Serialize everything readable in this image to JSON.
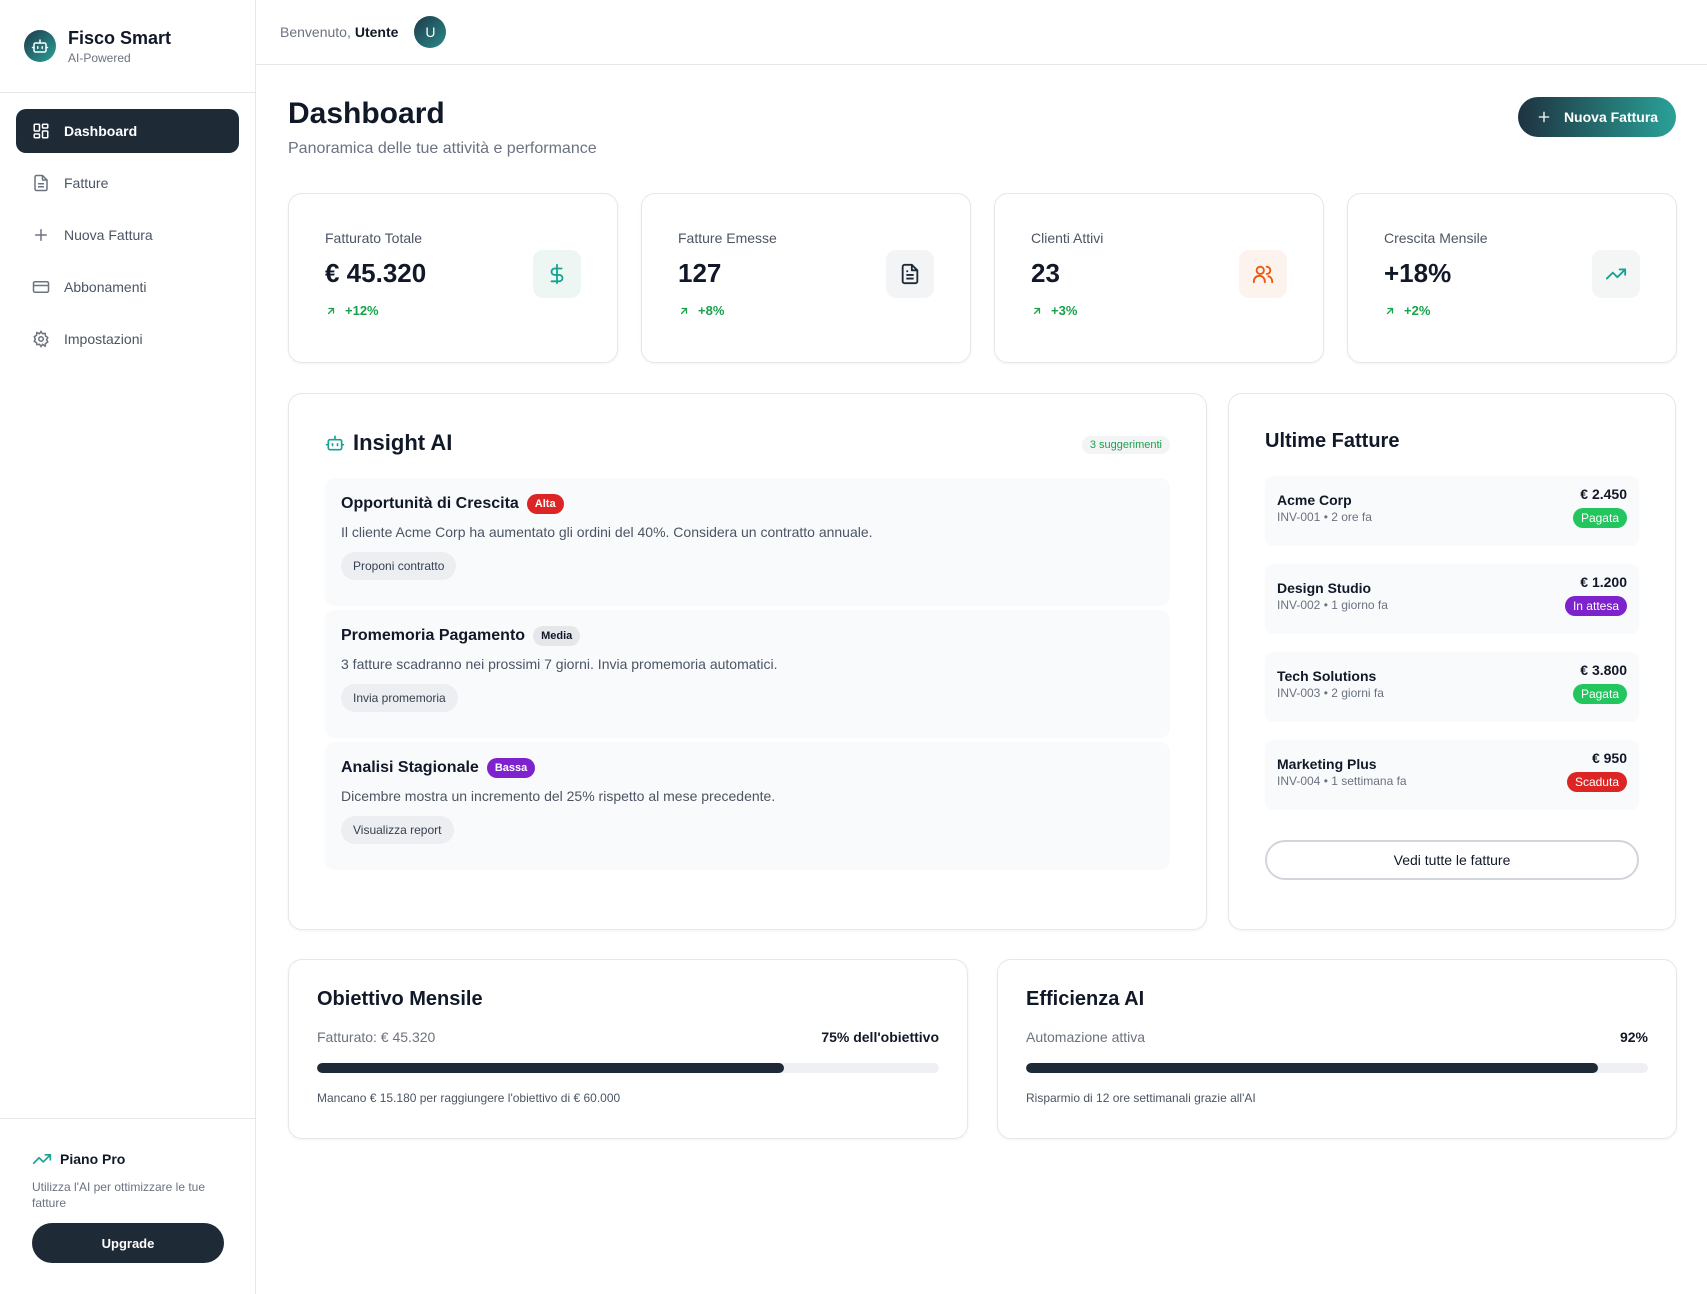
{
  "brand": {
    "title": "Fisco Smart",
    "subtitle": "AI-Powered"
  },
  "nav": [
    {
      "label": "Dashboard",
      "icon": "grid-icon",
      "active": true
    },
    {
      "label": "Fatture",
      "icon": "file-icon"
    },
    {
      "label": "Nuova Fattura",
      "icon": "plus-icon"
    },
    {
      "label": "Abbonamenti",
      "icon": "credit-card-icon"
    },
    {
      "label": "Impostazioni",
      "icon": "gear-icon"
    }
  ],
  "plan": {
    "title": "Piano Pro",
    "description": "Utilizza l'AI per ottimizzare le tue fatture",
    "button": "Upgrade"
  },
  "header": {
    "welcome": "Benvenuto,",
    "user": "Utente",
    "avatar_initial": "U"
  },
  "page": {
    "title": "Dashboard",
    "subtitle": "Panoramica delle tue attività e performance",
    "new_button": "Nuova Fattura"
  },
  "stats": [
    {
      "label": "Fatturato Totale",
      "value": "€ 45.320",
      "change": "+12%",
      "icon": "dollar-icon",
      "icon_color": "#16a394",
      "icon_bg": "#eef6f4"
    },
    {
      "label": "Fatture Emesse",
      "value": "127",
      "change": "+8%",
      "icon": "document-icon",
      "icon_color": "#1f2937",
      "icon_bg": "#f3f4f6"
    },
    {
      "label": "Clienti Attivi",
      "value": "23",
      "change": "+3%",
      "icon": "users-icon",
      "icon_color": "#ea580c",
      "icon_bg": "#fdf3ee"
    },
    {
      "label": "Crescita Mensile",
      "value": "+18%",
      "change": "+2%",
      "icon": "trending-up-icon",
      "icon_color": "#16a394",
      "icon_bg": "#f3f6f5"
    }
  ],
  "insight": {
    "title": "Insight AI",
    "badge": "3 suggerimenti",
    "items": [
      {
        "title": "Opportunità di Crescita",
        "priority": "Alta",
        "priority_bg": "#dc2626",
        "priority_color": "#ffffff",
        "description": "Il cliente Acme Corp ha aumentato gli ordini del 40%. Considera un contratto annuale.",
        "action": "Proponi contratto"
      },
      {
        "title": "Promemoria Pagamento",
        "priority": "Media",
        "priority_bg": "#e5e7eb",
        "priority_color": "#111827",
        "description": "3 fatture scadranno nei prossimi 7 giorni. Invia promemoria automatici.",
        "action": "Invia promemoria"
      },
      {
        "title": "Analisi Stagionale",
        "priority": "Bassa",
        "priority_bg": "#7e22ce",
        "priority_color": "#ffffff",
        "description": "Dicembre mostra un incremento del 25% rispetto al mese precedente.",
        "action": "Visualizza report"
      }
    ]
  },
  "invoices": {
    "title": "Ultime Fatture",
    "items": [
      {
        "client": "Acme Corp",
        "meta": "INV-001 • 2 ore fa",
        "amount": "€ 2.450",
        "status": "Pagata",
        "status_color": "#22c55e"
      },
      {
        "client": "Design Studio",
        "meta": "INV-002 • 1 giorno fa",
        "amount": "€ 1.200",
        "status": "In attesa",
        "status_color": "#7e22ce"
      },
      {
        "client": "Tech Solutions",
        "meta": "INV-003 • 2 giorni fa",
        "amount": "€ 3.800",
        "status": "Pagata",
        "status_color": "#22c55e"
      },
      {
        "client": "Marketing Plus",
        "meta": "INV-004 • 1 settimana fa",
        "amount": "€ 950",
        "status": "Scaduta",
        "status_color": "#dc2626"
      }
    ],
    "see_all": "Vedi tutte le fatture"
  },
  "goal": {
    "title": "Obiettivo Mensile",
    "left": "Fatturato: € 45.320",
    "right": "75% dell'obiettivo",
    "progress": 0.75,
    "note": "Mancano € 15.180 per raggiungere l'obiettivo di € 60.000"
  },
  "efficiency": {
    "title": "Efficienza AI",
    "left": "Automazione attiva",
    "right": "92%",
    "progress": 0.92,
    "note": "Risparmio di 12 ore settimanali grazie all'AI"
  }
}
